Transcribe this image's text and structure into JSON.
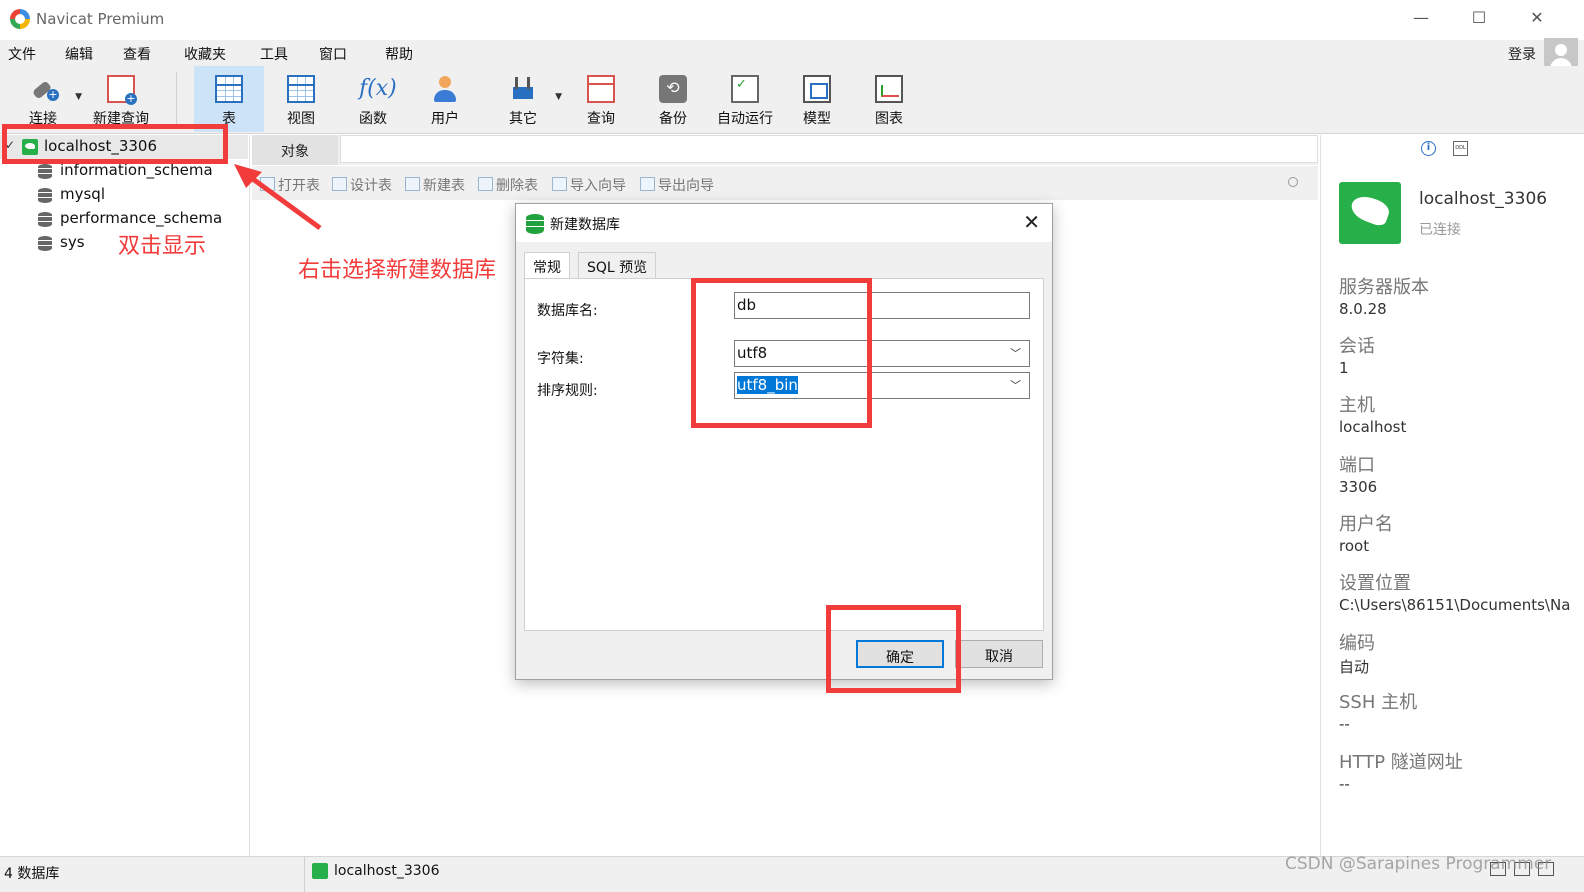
{
  "window": {
    "title": "Navicat Premium",
    "minimize": "—",
    "maximize": "☐",
    "close": "✕"
  },
  "menu": [
    "文件",
    "编辑",
    "查看",
    "收藏夹",
    "工具",
    "窗口",
    "帮助"
  ],
  "account": {
    "login": "登录"
  },
  "toolbar": [
    "连接",
    "新建查询",
    "表",
    "视图",
    "函数",
    "用户",
    "其它",
    "查询",
    "备份",
    "自动运行",
    "模型",
    "图表"
  ],
  "tree": {
    "root": "localhost_3306",
    "databases": [
      "information_schema",
      "mysql",
      "performance_schema",
      "sys"
    ]
  },
  "annotations": {
    "double_click": "双击显示",
    "right_click": "右击选择新建数据库"
  },
  "objects": {
    "tab": "对象",
    "actions": [
      "打开表",
      "设计表",
      "新建表",
      "删除表",
      "导入向导",
      "导出向导"
    ]
  },
  "dialog": {
    "title": "新建数据库",
    "tabs": [
      "常规",
      "SQL 预览"
    ],
    "fields": {
      "name_label": "数据库名:",
      "name_value": "db",
      "charset_label": "字符集:",
      "charset_value": "utf8",
      "collation_label": "排序规则:",
      "collation_value": "utf8_bin"
    },
    "ok": "确定",
    "cancel": "取消"
  },
  "info": {
    "name": "localhost_3306",
    "status": "已连接",
    "props": [
      {
        "label": "服务器版本",
        "value": "8.0.28"
      },
      {
        "label": "会话",
        "value": "1"
      },
      {
        "label": "主机",
        "value": "localhost"
      },
      {
        "label": "端口",
        "value": "3306"
      },
      {
        "label": "用户名",
        "value": "root"
      },
      {
        "label": "设置位置",
        "value": "C:\\Users\\86151\\Documents\\Na"
      },
      {
        "label": "编码",
        "value": "自动"
      },
      {
        "label": "SSH 主机",
        "value": "--"
      },
      {
        "label": "HTTP 隧道网址",
        "value": "--"
      }
    ]
  },
  "status": {
    "count": "4 数据库",
    "connection": "localhost_3306"
  },
  "watermark": "CSDN @Sarapines Programmer",
  "colors": {
    "annotation": "#f23b3b",
    "selection": "#0078d7",
    "connection_green": "#27b04a",
    "active_tool": "#cde3f7"
  }
}
